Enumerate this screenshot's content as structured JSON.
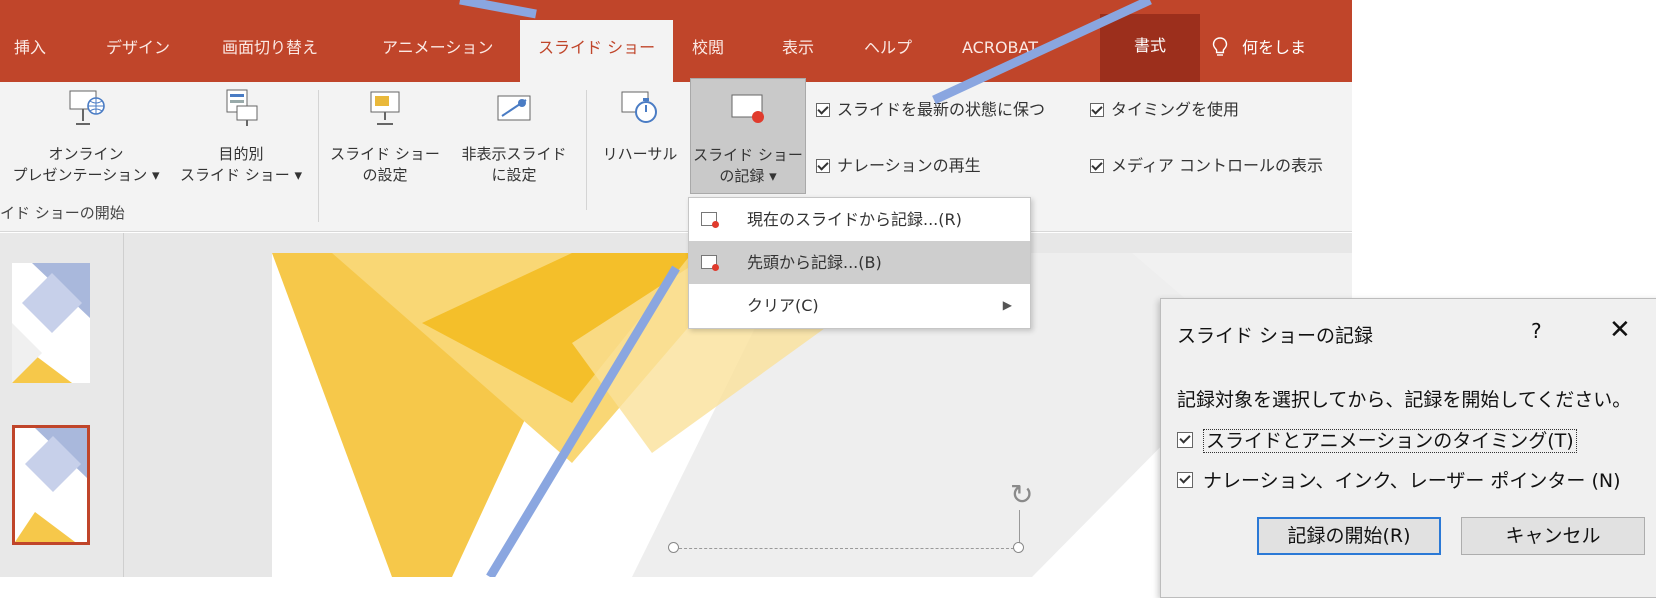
{
  "ribbon_tabs": [
    {
      "label": "挿入"
    },
    {
      "label": "デザイン"
    },
    {
      "label": "画面切り替え"
    },
    {
      "label": "アニメーション"
    },
    {
      "label": "スライド ショー",
      "active": true
    },
    {
      "label": "校閲"
    },
    {
      "label": "表示"
    },
    {
      "label": "ヘルプ"
    },
    {
      "label": "ACROBAT"
    },
    {
      "label": "書式"
    }
  ],
  "tell_me": "何をしま",
  "ribbon": {
    "online_line1": "オンライン",
    "online_line2": "プレゼンテーション ▾",
    "custom_line1": "目的別",
    "custom_line2": "スライド ショー ▾",
    "group_label": "イド ショーの開始",
    "setup_line1": "スライド ショー",
    "setup_line2": "の設定",
    "hide_line1": "非表示スライド",
    "hide_line2": "に設定",
    "rehearse": "リハーサル",
    "record_line1": "スライド ショー",
    "record_line2": "の記録 ▾",
    "keep_updated": "スライドを最新の状態に保つ",
    "play_narration": "ナレーションの再生",
    "use_timings": "タイミングを使用",
    "show_media_controls": "メディア コントロールの表示"
  },
  "record_menu": {
    "items": [
      {
        "label": "現在のスライドから記録...(R)"
      },
      {
        "label": "先頭から記録...(B)"
      },
      {
        "label": "クリア(C)"
      }
    ]
  },
  "dialog": {
    "title": "スライド ショーの記録",
    "help": "?",
    "close": "✕",
    "message": "記録対象を選択してから、記録を開始してください。",
    "opt_timings": "スライドとアニメーションのタイミング(T)",
    "opt_narration": "ナレーション、インク、レーザー ポインター (N)",
    "start_button": "記録の開始(R)",
    "cancel_button": "キャンセル"
  },
  "colors": {
    "ribbon_accent": "#c0452a",
    "format_tab": "#9c2f1c",
    "annotation_line": "#8aa6e0",
    "slide_yellow": "#f6c84a"
  },
  "icons": {
    "rotate": "↻"
  }
}
